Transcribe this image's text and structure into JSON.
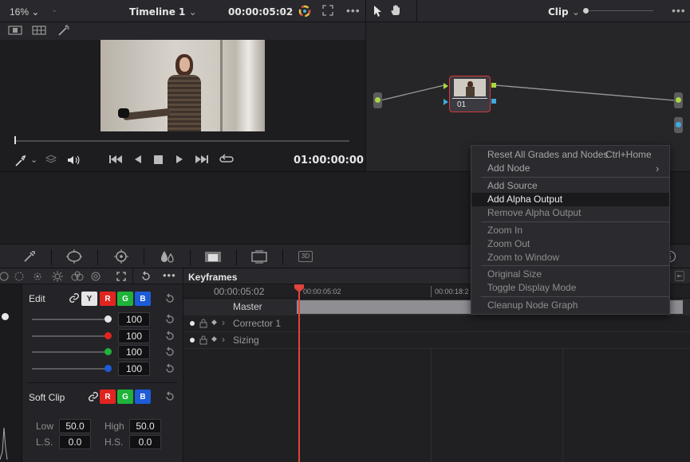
{
  "viewer": {
    "zoom": "16%",
    "timeline_name": "Timeline 1",
    "timecode": "00:00:05:02",
    "playhead_timecode": "01:00:00:00"
  },
  "node_editor": {
    "mode": "Clip",
    "node_label": "01"
  },
  "context_menu": {
    "items": [
      {
        "label": "Reset All Grades and Nodes",
        "shortcut": "Ctrl+Home"
      },
      {
        "label": "Add Node",
        "submenu": "›"
      },
      {
        "label": "Add Source"
      },
      {
        "label": "Add Alpha Output"
      },
      {
        "label": "Remove Alpha Output"
      },
      {
        "label": "Zoom In"
      },
      {
        "label": "Zoom Out"
      },
      {
        "label": "Zoom to Window"
      },
      {
        "label": "Original Size"
      },
      {
        "label": "Toggle Display Mode"
      },
      {
        "label": "Cleanup Node Graph"
      }
    ],
    "highlighted": "Add Alpha Output"
  },
  "toolbar": {
    "three_d_label": "3D"
  },
  "curves": {
    "edit_label": "Edit",
    "channels": {
      "y": "Y",
      "r": "R",
      "g": "G",
      "b": "B"
    },
    "values": [
      "100",
      "100",
      "100",
      "100"
    ],
    "soft_clip_label": "Soft Clip",
    "low_label": "Low",
    "low_value": "50.0",
    "high_label": "High",
    "high_value": "50.0",
    "ls_label": "L.S.",
    "ls_value": "0.0",
    "hs_label": "H.S.",
    "hs_value": "0.0"
  },
  "keyframes": {
    "title": "Keyframes",
    "current_timecode": "00:00:05:02",
    "ruler_marks": [
      "00:00:05:02",
      "00:00:18:2"
    ],
    "master_label": "Master",
    "tracks": [
      "Corrector 1",
      "Sizing"
    ]
  },
  "colors": {
    "accent_red": "#e0443a",
    "highlight_row": "#1a1a1d",
    "node_border": "#d63a3a"
  }
}
